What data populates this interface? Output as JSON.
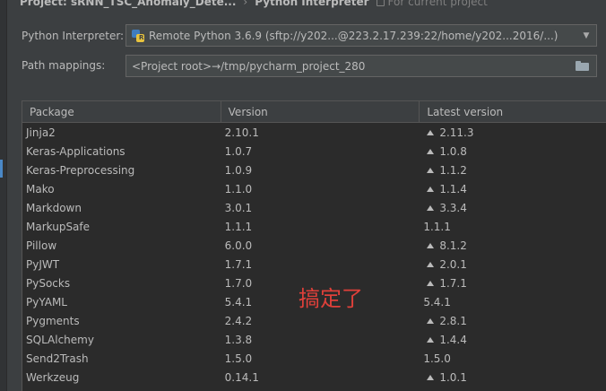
{
  "breadcrumb": {
    "project": "Project: sRNN_TSC_Anomaly_Dete...",
    "separator": "›",
    "page": "Python Interpreter",
    "scope": "For current project"
  },
  "interpreter": {
    "label": "Python Interpreter:",
    "value": "Remote Python 3.6.9 (sftp://y202...@223.2.17.239:22/home/y202...2016/...)"
  },
  "path_mappings": {
    "label": "Path mappings:",
    "value": "<Project root>→/tmp/pycharm_project_280"
  },
  "table": {
    "columns": [
      "Package",
      "Version",
      "Latest version"
    ],
    "rows": [
      {
        "package": "Jinja2",
        "version": "2.10.1",
        "latest": "2.11.3",
        "upgrade": true
      },
      {
        "package": "Keras-Applications",
        "version": "1.0.7",
        "latest": "1.0.8",
        "upgrade": true
      },
      {
        "package": "Keras-Preprocessing",
        "version": "1.0.9",
        "latest": "1.1.2",
        "upgrade": true
      },
      {
        "package": "Mako",
        "version": "1.1.0",
        "latest": "1.1.4",
        "upgrade": true
      },
      {
        "package": "Markdown",
        "version": "3.0.1",
        "latest": "3.3.4",
        "upgrade": true
      },
      {
        "package": "MarkupSafe",
        "version": "1.1.1",
        "latest": "1.1.1",
        "upgrade": false
      },
      {
        "package": "Pillow",
        "version": "6.0.0",
        "latest": "8.1.2",
        "upgrade": true
      },
      {
        "package": "PyJWT",
        "version": "1.7.1",
        "latest": "2.0.1",
        "upgrade": true
      },
      {
        "package": "PySocks",
        "version": "1.7.0",
        "latest": "1.7.1",
        "upgrade": true
      },
      {
        "package": "PyYAML",
        "version": "5.4.1",
        "latest": "5.4.1",
        "upgrade": false
      },
      {
        "package": "Pygments",
        "version": "2.4.2",
        "latest": "2.8.1",
        "upgrade": true
      },
      {
        "package": "SQLAlchemy",
        "version": "1.3.8",
        "latest": "1.4.4",
        "upgrade": true
      },
      {
        "package": "Send2Trash",
        "version": "1.5.0",
        "latest": "1.5.0",
        "upgrade": false
      },
      {
        "package": "Werkzeug",
        "version": "0.14.1",
        "latest": "1.0.1",
        "upgrade": true
      }
    ]
  },
  "annotation": "搞定了",
  "icons": {
    "interpreter": "python-remote-icon",
    "browse": "folder-icon",
    "upgrade": "upgrade-arrow-icon",
    "dropdown": "chevron-down-icon"
  },
  "colors": {
    "background": "#3c3f41",
    "table_background": "#2b2b2b",
    "text": "#bbbbbb",
    "annotation": "#e0403a"
  }
}
